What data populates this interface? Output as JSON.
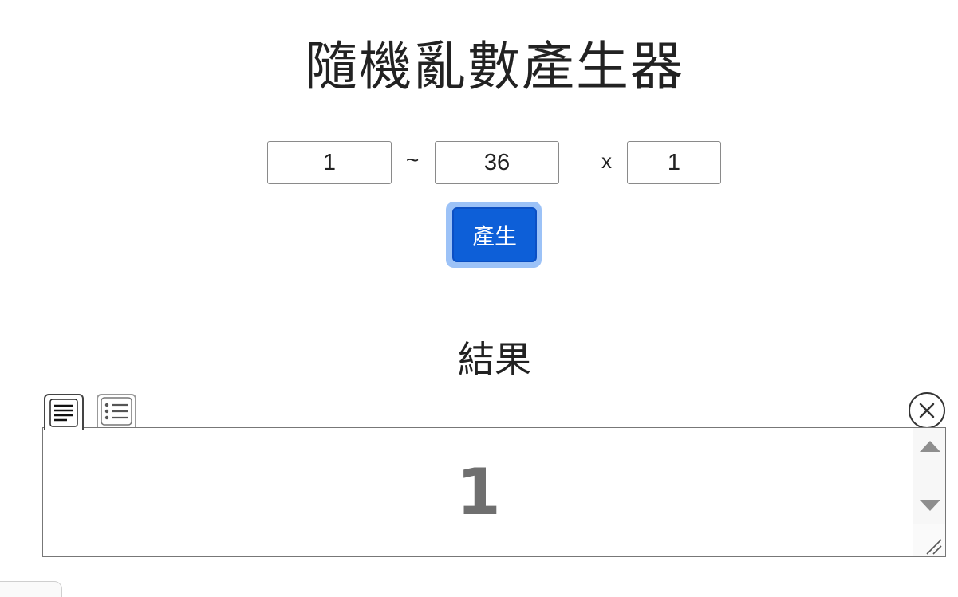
{
  "page": {
    "title": "隨機亂數產生器"
  },
  "range": {
    "min_value": "1",
    "separator": "~",
    "max_value": "36",
    "times_symbol": "x",
    "count_value": "1"
  },
  "actions": {
    "generate_label": "產生"
  },
  "result": {
    "heading": "結果",
    "value": "1",
    "view_modes": [
      "text-view-icon",
      "list-view-icon"
    ],
    "clear_icon": "close-circle-icon"
  },
  "colors": {
    "accent": "#0d5fd8",
    "accent_ring": "#9cc2f7",
    "result_text": "#6f6f6f"
  }
}
